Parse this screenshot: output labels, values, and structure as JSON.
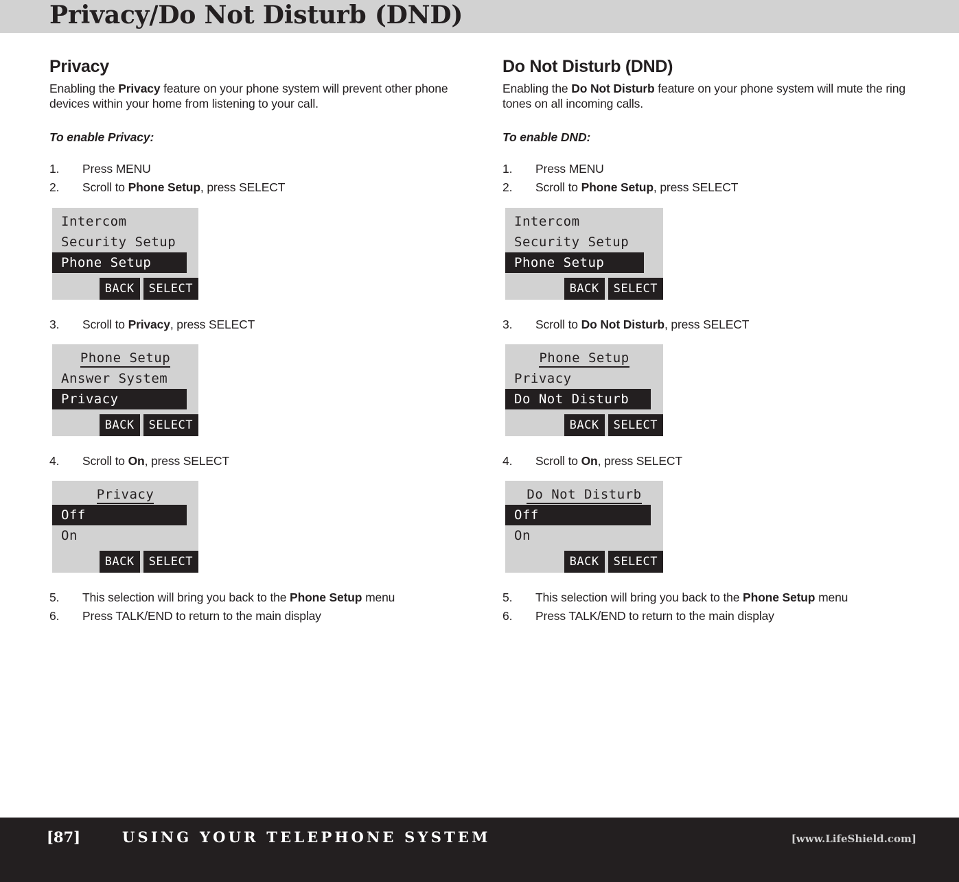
{
  "header": {
    "title": "Privacy/Do Not Disturb (DND)",
    "background_color": "#d2d2d2"
  },
  "colors": {
    "ink": "#231f20",
    "lcd_background": "#d2d2d2",
    "lcd_highlight": "#231f20",
    "lcd_highlight_text": "#ffffff",
    "footer_background": "#231f20"
  },
  "left_column": {
    "section_title": "Privacy",
    "intro_prefix": "Enabling the ",
    "intro_bold": "Privacy",
    "intro_suffix": " feature on your phone system will prevent other phone devices within your home from listening to your call.",
    "enable_label": "To enable Privacy:",
    "step1_num": "1.",
    "step1_text": "Press MENU",
    "step2_num": "2.",
    "step2_prefix": "Scroll to ",
    "step2_bold": "Phone Setup",
    "step2_suffix": ", press SELECT",
    "step3_num": "3.",
    "step3_prefix": "Scroll to ",
    "step3_bold": "Privacy",
    "step3_suffix": ", press SELECT",
    "step4_num": "4.",
    "step4_prefix": "Scroll to ",
    "step4_bold": "On",
    "step4_suffix": ", press SELECT",
    "step5_num": "5.",
    "step5_prefix": "This selection will bring you back to the ",
    "step5_bold": "Phone Setup",
    "step5_suffix": " menu",
    "step6_num": "6.",
    "step6_text": "Press TALK/END to return to the main display",
    "screen1": {
      "row1": "Intercom",
      "row2": "Security Setup",
      "row3": "Phone Setup",
      "back": "BACK",
      "select": "SELECT"
    },
    "screen2": {
      "title": "Phone Setup",
      "row2": "Answer System",
      "row3": "Privacy",
      "back": "BACK",
      "select": "SELECT"
    },
    "screen3": {
      "title": "Privacy",
      "row2": "Off",
      "row3": "On",
      "back": "BACK",
      "select": "SELECT"
    }
  },
  "right_column": {
    "section_title": "Do Not Disturb (DND)",
    "intro_prefix": "Enabling the ",
    "intro_bold": "Do Not Disturb",
    "intro_suffix": " feature on your phone system will mute the ring tones on all incoming calls.",
    "enable_label": "To enable DND:",
    "step1_num": "1.",
    "step1_text": "Press MENU",
    "step2_num": "2.",
    "step2_prefix": "Scroll to ",
    "step2_bold": "Phone Setup",
    "step2_suffix": ", press SELECT",
    "step3_num": "3.",
    "step3_prefix": "Scroll to ",
    "step3_bold": "Do Not Disturb",
    "step3_suffix": ", press SELECT",
    "step4_num": "4.",
    "step4_prefix": "Scroll to ",
    "step4_bold": "On",
    "step4_suffix": ", press SELECT",
    "step5_num": "5.",
    "step5_prefix": "This selection will bring you back to the ",
    "step5_bold": "Phone Setup",
    "step5_suffix": " menu",
    "step6_num": "6.",
    "step6_text": "Press TALK/END to return to the main display",
    "screen1": {
      "row1": "Intercom",
      "row2": "Security Setup",
      "row3": "Phone Setup",
      "back": "BACK",
      "select": "SELECT"
    },
    "screen2": {
      "title": "Phone Setup",
      "row2": "Privacy",
      "row3": "Do Not Disturb",
      "back": "BACK",
      "select": "SELECT"
    },
    "screen3": {
      "title": "Do Not Disturb",
      "row2": "Off",
      "row3": "On",
      "back": "BACK",
      "select": "SELECT"
    }
  },
  "footer": {
    "page_number": "[87]",
    "caption": "USING YOUR TELEPHONE SYSTEM",
    "url": "[www.LifeShield.com]"
  }
}
